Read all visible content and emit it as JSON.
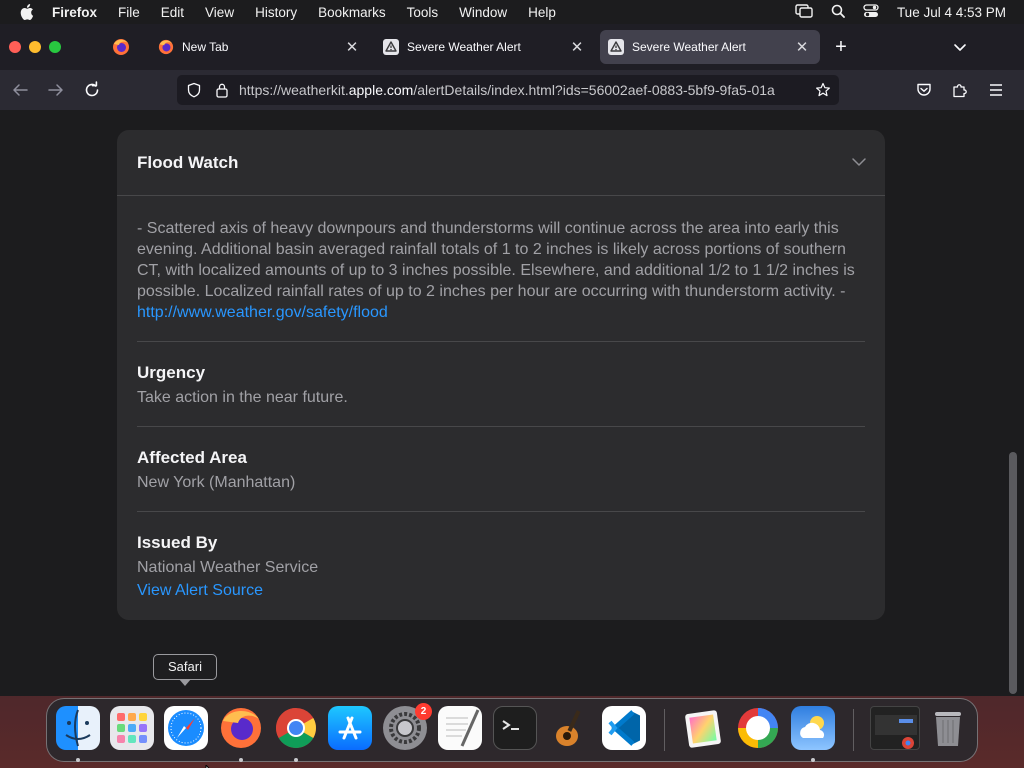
{
  "menubar": {
    "app_name": "Firefox",
    "items": [
      "File",
      "Edit",
      "View",
      "History",
      "Bookmarks",
      "Tools",
      "Window",
      "Help"
    ],
    "clock": "Tue Jul 4  4:53 PM"
  },
  "tabs": [
    {
      "label": "New Tab",
      "icon": "firefox-icon",
      "active": false
    },
    {
      "label": "Severe Weather Alert",
      "icon": "warning-icon",
      "active": false
    },
    {
      "label": "Severe Weather Alert",
      "icon": "warning-icon",
      "active": true
    }
  ],
  "urlbar": {
    "prefix": "https://weatherkit.",
    "domain": "apple.com",
    "suffix": "/alertDetails/index.html?ids=56002aef-0883-5bf9-9fa5-01a"
  },
  "alert": {
    "title": "Flood Watch",
    "description": "- Scattered axis of heavy downpours and thunderstorms will continue across the area into early this evening. Additional basin averaged rainfall totals of 1 to 2 inches is likely across portions of southern CT, with localized amounts of up to 3 inches possible. Elsewhere, and additional 1/2 to 1 1/2 inches is possible. Localized rainfall rates of up to 2 inches per hour are occurring with thunderstorm activity. - ",
    "description_link": "http://www.weather.gov/safety/flood",
    "urgency_label": "Urgency",
    "urgency_value": "Take action in the near future.",
    "area_label": "Affected Area",
    "area_value": "New York (Manhattan)",
    "issued_label": "Issued By",
    "issued_value": "National Weather Service",
    "source_link": "View Alert Source"
  },
  "dock": {
    "tooltip": "Safari",
    "apps": [
      {
        "name": "finder-icon",
        "running": true
      },
      {
        "name": "launchpad-icon",
        "running": false
      },
      {
        "name": "safari-icon",
        "running": false
      },
      {
        "name": "firefox-icon",
        "running": true
      },
      {
        "name": "chrome-icon",
        "running": true
      },
      {
        "name": "app-store-icon",
        "running": false
      },
      {
        "name": "system-settings-icon",
        "running": false,
        "badge": "2"
      },
      {
        "name": "textedit-icon",
        "running": false
      },
      {
        "name": "terminal-icon",
        "running": false
      },
      {
        "name": "garageband-icon",
        "running": false
      },
      {
        "name": "vscode-icon",
        "running": false
      },
      {
        "name": "preview-icon",
        "running": false
      },
      {
        "name": "photo-booth-icon",
        "running": false
      },
      {
        "name": "weather-icon",
        "running": true
      },
      {
        "name": "chrome-window-thumbnail-icon",
        "running": false
      },
      {
        "name": "trash-icon",
        "running": false
      }
    ]
  },
  "colors": {
    "accent_link": "#2997ff",
    "card_bg": "#2c2c2e",
    "page_bg": "#1c1c1e"
  }
}
